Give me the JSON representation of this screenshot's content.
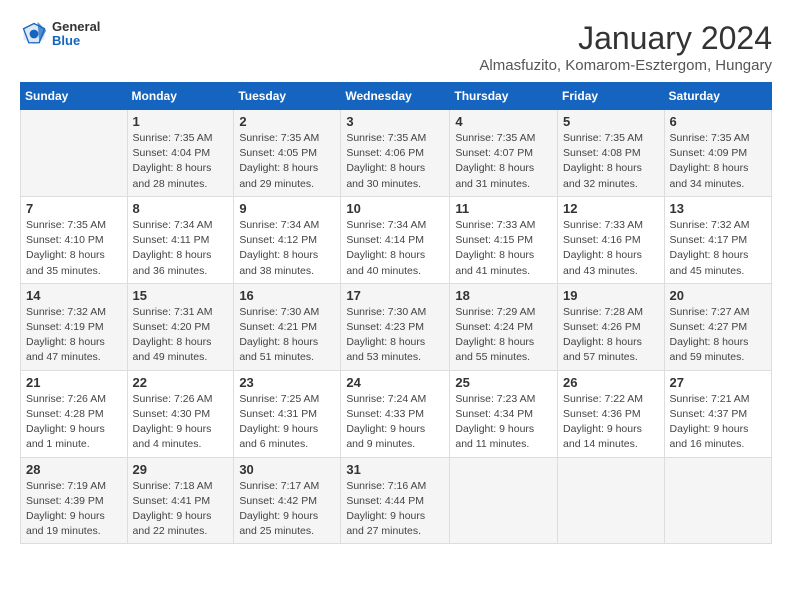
{
  "header": {
    "month_title": "January 2024",
    "location": "Almasfuzito, Komarom-Esztergom, Hungary",
    "logo_general": "General",
    "logo_blue": "Blue"
  },
  "days_of_week": [
    "Sunday",
    "Monday",
    "Tuesday",
    "Wednesday",
    "Thursday",
    "Friday",
    "Saturday"
  ],
  "weeks": [
    [
      {
        "day": "",
        "info": ""
      },
      {
        "day": "1",
        "info": "Sunrise: 7:35 AM\nSunset: 4:04 PM\nDaylight: 8 hours\nand 28 minutes."
      },
      {
        "day": "2",
        "info": "Sunrise: 7:35 AM\nSunset: 4:05 PM\nDaylight: 8 hours\nand 29 minutes."
      },
      {
        "day": "3",
        "info": "Sunrise: 7:35 AM\nSunset: 4:06 PM\nDaylight: 8 hours\nand 30 minutes."
      },
      {
        "day": "4",
        "info": "Sunrise: 7:35 AM\nSunset: 4:07 PM\nDaylight: 8 hours\nand 31 minutes."
      },
      {
        "day": "5",
        "info": "Sunrise: 7:35 AM\nSunset: 4:08 PM\nDaylight: 8 hours\nand 32 minutes."
      },
      {
        "day": "6",
        "info": "Sunrise: 7:35 AM\nSunset: 4:09 PM\nDaylight: 8 hours\nand 34 minutes."
      }
    ],
    [
      {
        "day": "7",
        "info": "Daylight: 8 hours\nand 35 minutes."
      },
      {
        "day": "8",
        "info": "Sunrise: 7:34 AM\nSunset: 4:11 PM\nDaylight: 8 hours\nand 36 minutes."
      },
      {
        "day": "9",
        "info": "Sunrise: 7:34 AM\nSunset: 4:12 PM\nDaylight: 8 hours\nand 38 minutes."
      },
      {
        "day": "10",
        "info": "Sunrise: 7:34 AM\nSunset: 4:14 PM\nDaylight: 8 hours\nand 40 minutes."
      },
      {
        "day": "11",
        "info": "Sunrise: 7:33 AM\nSunset: 4:15 PM\nDaylight: 8 hours\nand 41 minutes."
      },
      {
        "day": "12",
        "info": "Sunrise: 7:33 AM\nSunset: 4:16 PM\nDaylight: 8 hours\nand 43 minutes."
      },
      {
        "day": "13",
        "info": "Sunrise: 7:32 AM\nSunset: 4:17 PM\nDaylight: 8 hours\nand 45 minutes."
      }
    ],
    [
      {
        "day": "14",
        "info": "Sunrise: 7:32 AM\nSunset: 4:19 PM\nDaylight: 8 hours\nand 47 minutes."
      },
      {
        "day": "15",
        "info": "Sunrise: 7:31 AM\nSunset: 4:20 PM\nDaylight: 8 hours\nand 49 minutes."
      },
      {
        "day": "16",
        "info": "Sunrise: 7:30 AM\nSunset: 4:21 PM\nDaylight: 8 hours\nand 51 minutes."
      },
      {
        "day": "17",
        "info": "Sunrise: 7:30 AM\nSunset: 4:23 PM\nDaylight: 8 hours\nand 53 minutes."
      },
      {
        "day": "18",
        "info": "Sunrise: 7:29 AM\nSunset: 4:24 PM\nDaylight: 8 hours\nand 55 minutes."
      },
      {
        "day": "19",
        "info": "Sunrise: 7:28 AM\nSunset: 4:26 PM\nDaylight: 8 hours\nand 57 minutes."
      },
      {
        "day": "20",
        "info": "Sunrise: 7:27 AM\nSunset: 4:27 PM\nDaylight: 8 hours\nand 59 minutes."
      }
    ],
    [
      {
        "day": "21",
        "info": "Sunrise: 7:26 AM\nSunset: 4:28 PM\nDaylight: 9 hours\nand 1 minute."
      },
      {
        "day": "22",
        "info": "Sunrise: 7:26 AM\nSunset: 4:30 PM\nDaylight: 9 hours\nand 4 minutes."
      },
      {
        "day": "23",
        "info": "Sunrise: 7:25 AM\nSunset: 4:31 PM\nDaylight: 9 hours\nand 6 minutes."
      },
      {
        "day": "24",
        "info": "Sunrise: 7:24 AM\nSunset: 4:33 PM\nDaylight: 9 hours\nand 9 minutes."
      },
      {
        "day": "25",
        "info": "Sunrise: 7:23 AM\nSunset: 4:34 PM\nDaylight: 9 hours\nand 11 minutes."
      },
      {
        "day": "26",
        "info": "Sunrise: 7:22 AM\nSunset: 4:36 PM\nDaylight: 9 hours\nand 14 minutes."
      },
      {
        "day": "27",
        "info": "Sunrise: 7:21 AM\nSunset: 4:37 PM\nDaylight: 9 hours\nand 16 minutes."
      }
    ],
    [
      {
        "day": "28",
        "info": "Sunrise: 7:19 AM\nSunset: 4:39 PM\nDaylight: 9 hours\nand 19 minutes."
      },
      {
        "day": "29",
        "info": "Sunrise: 7:18 AM\nSunset: 4:41 PM\nDaylight: 9 hours\nand 22 minutes."
      },
      {
        "day": "30",
        "info": "Sunrise: 7:17 AM\nSunset: 4:42 PM\nDaylight: 9 hours\nand 25 minutes."
      },
      {
        "day": "31",
        "info": "Sunrise: 7:16 AM\nSunset: 4:44 PM\nDaylight: 9 hours\nand 27 minutes."
      },
      {
        "day": "",
        "info": ""
      },
      {
        "day": "",
        "info": ""
      },
      {
        "day": "",
        "info": ""
      }
    ]
  ],
  "week7_sunday_info": "Sunrise: 7:35 AM\nSunset: 4:10 PM\nDaylight: 8 hours\nand 35 minutes."
}
